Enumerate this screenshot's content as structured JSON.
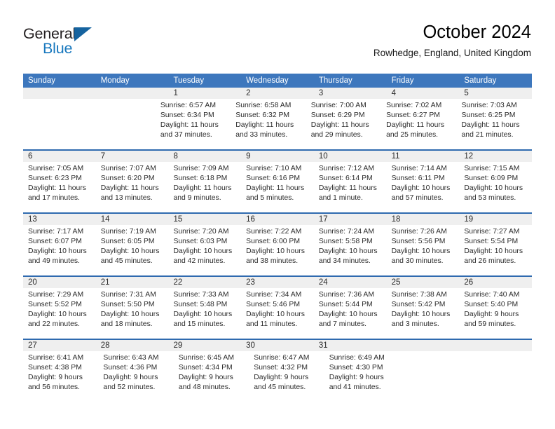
{
  "brand": {
    "word_general": "General",
    "word_blue": "Blue",
    "triangle_color": "#15639f",
    "blue_color": "#1878be"
  },
  "header": {
    "title": "October 2024",
    "subtitle": "Rowhedge, England, United Kingdom"
  },
  "theme": {
    "header_blue": "#3d77bd",
    "separator_blue": "#2f6aaf",
    "band_gray": "#efefef",
    "text_color": "#2b2b2b"
  },
  "weekdays": [
    "Sunday",
    "Monday",
    "Tuesday",
    "Wednesday",
    "Thursday",
    "Friday",
    "Saturday"
  ],
  "weeks": [
    {
      "numbers": [
        "",
        "",
        "1",
        "2",
        "3",
        "4",
        "5"
      ],
      "days": [
        {
          "blank": true
        },
        {
          "blank": true
        },
        {
          "sunrise": "Sunrise: 6:57 AM",
          "sunset": "Sunset: 6:34 PM",
          "daylight_1": "Daylight: 11 hours",
          "daylight_2": "and 37 minutes."
        },
        {
          "sunrise": "Sunrise: 6:58 AM",
          "sunset": "Sunset: 6:32 PM",
          "daylight_1": "Daylight: 11 hours",
          "daylight_2": "and 33 minutes."
        },
        {
          "sunrise": "Sunrise: 7:00 AM",
          "sunset": "Sunset: 6:29 PM",
          "daylight_1": "Daylight: 11 hours",
          "daylight_2": "and 29 minutes."
        },
        {
          "sunrise": "Sunrise: 7:02 AM",
          "sunset": "Sunset: 6:27 PM",
          "daylight_1": "Daylight: 11 hours",
          "daylight_2": "and 25 minutes."
        },
        {
          "sunrise": "Sunrise: 7:03 AM",
          "sunset": "Sunset: 6:25 PM",
          "daylight_1": "Daylight: 11 hours",
          "daylight_2": "and 21 minutes."
        }
      ]
    },
    {
      "numbers": [
        "6",
        "7",
        "8",
        "9",
        "10",
        "11",
        "12"
      ],
      "days": [
        {
          "sunrise": "Sunrise: 7:05 AM",
          "sunset": "Sunset: 6:23 PM",
          "daylight_1": "Daylight: 11 hours",
          "daylight_2": "and 17 minutes."
        },
        {
          "sunrise": "Sunrise: 7:07 AM",
          "sunset": "Sunset: 6:20 PM",
          "daylight_1": "Daylight: 11 hours",
          "daylight_2": "and 13 minutes."
        },
        {
          "sunrise": "Sunrise: 7:09 AM",
          "sunset": "Sunset: 6:18 PM",
          "daylight_1": "Daylight: 11 hours",
          "daylight_2": "and 9 minutes."
        },
        {
          "sunrise": "Sunrise: 7:10 AM",
          "sunset": "Sunset: 6:16 PM",
          "daylight_1": "Daylight: 11 hours",
          "daylight_2": "and 5 minutes."
        },
        {
          "sunrise": "Sunrise: 7:12 AM",
          "sunset": "Sunset: 6:14 PM",
          "daylight_1": "Daylight: 11 hours",
          "daylight_2": "and 1 minute."
        },
        {
          "sunrise": "Sunrise: 7:14 AM",
          "sunset": "Sunset: 6:11 PM",
          "daylight_1": "Daylight: 10 hours",
          "daylight_2": "and 57 minutes."
        },
        {
          "sunrise": "Sunrise: 7:15 AM",
          "sunset": "Sunset: 6:09 PM",
          "daylight_1": "Daylight: 10 hours",
          "daylight_2": "and 53 minutes."
        }
      ]
    },
    {
      "numbers": [
        "13",
        "14",
        "15",
        "16",
        "17",
        "18",
        "19"
      ],
      "days": [
        {
          "sunrise": "Sunrise: 7:17 AM",
          "sunset": "Sunset: 6:07 PM",
          "daylight_1": "Daylight: 10 hours",
          "daylight_2": "and 49 minutes."
        },
        {
          "sunrise": "Sunrise: 7:19 AM",
          "sunset": "Sunset: 6:05 PM",
          "daylight_1": "Daylight: 10 hours",
          "daylight_2": "and 45 minutes."
        },
        {
          "sunrise": "Sunrise: 7:20 AM",
          "sunset": "Sunset: 6:03 PM",
          "daylight_1": "Daylight: 10 hours",
          "daylight_2": "and 42 minutes."
        },
        {
          "sunrise": "Sunrise: 7:22 AM",
          "sunset": "Sunset: 6:00 PM",
          "daylight_1": "Daylight: 10 hours",
          "daylight_2": "and 38 minutes."
        },
        {
          "sunrise": "Sunrise: 7:24 AM",
          "sunset": "Sunset: 5:58 PM",
          "daylight_1": "Daylight: 10 hours",
          "daylight_2": "and 34 minutes."
        },
        {
          "sunrise": "Sunrise: 7:26 AM",
          "sunset": "Sunset: 5:56 PM",
          "daylight_1": "Daylight: 10 hours",
          "daylight_2": "and 30 minutes."
        },
        {
          "sunrise": "Sunrise: 7:27 AM",
          "sunset": "Sunset: 5:54 PM",
          "daylight_1": "Daylight: 10 hours",
          "daylight_2": "and 26 minutes."
        }
      ]
    },
    {
      "numbers": [
        "20",
        "21",
        "22",
        "23",
        "24",
        "25",
        "26"
      ],
      "days": [
        {
          "sunrise": "Sunrise: 7:29 AM",
          "sunset": "Sunset: 5:52 PM",
          "daylight_1": "Daylight: 10 hours",
          "daylight_2": "and 22 minutes."
        },
        {
          "sunrise": "Sunrise: 7:31 AM",
          "sunset": "Sunset: 5:50 PM",
          "daylight_1": "Daylight: 10 hours",
          "daylight_2": "and 18 minutes."
        },
        {
          "sunrise": "Sunrise: 7:33 AM",
          "sunset": "Sunset: 5:48 PM",
          "daylight_1": "Daylight: 10 hours",
          "daylight_2": "and 15 minutes."
        },
        {
          "sunrise": "Sunrise: 7:34 AM",
          "sunset": "Sunset: 5:46 PM",
          "daylight_1": "Daylight: 10 hours",
          "daylight_2": "and 11 minutes."
        },
        {
          "sunrise": "Sunrise: 7:36 AM",
          "sunset": "Sunset: 5:44 PM",
          "daylight_1": "Daylight: 10 hours",
          "daylight_2": "and 7 minutes."
        },
        {
          "sunrise": "Sunrise: 7:38 AM",
          "sunset": "Sunset: 5:42 PM",
          "daylight_1": "Daylight: 10 hours",
          "daylight_2": "and 3 minutes."
        },
        {
          "sunrise": "Sunrise: 7:40 AM",
          "sunset": "Sunset: 5:40 PM",
          "daylight_1": "Daylight: 9 hours",
          "daylight_2": "and 59 minutes."
        }
      ]
    },
    {
      "numbers": [
        "27",
        "28",
        "29",
        "30",
        "31",
        "",
        ""
      ],
      "days": [
        {
          "sunrise": "Sunrise: 6:41 AM",
          "sunset": "Sunset: 4:38 PM",
          "daylight_1": "Daylight: 9 hours",
          "daylight_2": "and 56 minutes."
        },
        {
          "sunrise": "Sunrise: 6:43 AM",
          "sunset": "Sunset: 4:36 PM",
          "daylight_1": "Daylight: 9 hours",
          "daylight_2": "and 52 minutes."
        },
        {
          "sunrise": "Sunrise: 6:45 AM",
          "sunset": "Sunset: 4:34 PM",
          "daylight_1": "Daylight: 9 hours",
          "daylight_2": "and 48 minutes."
        },
        {
          "sunrise": "Sunrise: 6:47 AM",
          "sunset": "Sunset: 4:32 PM",
          "daylight_1": "Daylight: 9 hours",
          "daylight_2": "and 45 minutes."
        },
        {
          "sunrise": "Sunrise: 6:49 AM",
          "sunset": "Sunset: 4:30 PM",
          "daylight_1": "Daylight: 9 hours",
          "daylight_2": "and 41 minutes."
        },
        {
          "blank": true
        },
        {
          "blank": true
        }
      ]
    }
  ]
}
